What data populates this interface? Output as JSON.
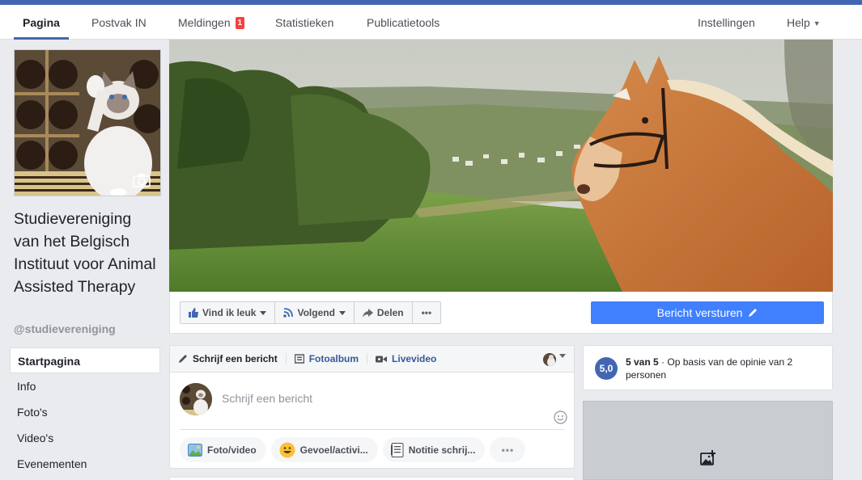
{
  "nav": {
    "tabs": [
      {
        "label": "Pagina"
      },
      {
        "label": "Postvak IN"
      },
      {
        "label": "Meldingen",
        "badge": "1"
      },
      {
        "label": "Statistieken"
      },
      {
        "label": "Publicatietools"
      }
    ],
    "settings": "Instellingen",
    "help": "Help",
    "help_caret": "▼"
  },
  "page": {
    "name": "Studievereniging van het Belgisch Instituut voor Animal Assisted Therapy",
    "handle": "@studievereniging"
  },
  "sidebar": {
    "items": [
      {
        "label": "Startpagina"
      },
      {
        "label": "Info"
      },
      {
        "label": "Foto's"
      },
      {
        "label": "Video's"
      },
      {
        "label": "Evenementen"
      }
    ]
  },
  "actions": {
    "like": "Vind ik leuk",
    "follow": "Volgend",
    "share": "Delen",
    "more": "•••",
    "send_message": "Bericht versturen"
  },
  "composer": {
    "tabs": [
      "Schrijf een bericht",
      "Fotoalbum",
      "Livevideo"
    ],
    "placeholder": "Schrijf een bericht",
    "buttons": [
      "Foto/video",
      "Gevoel/activi...",
      "Notitie schrij..."
    ],
    "more": "•••"
  },
  "rating": {
    "score": "5,0",
    "summary": "5 van 5",
    "separator": " · ",
    "detail": "Op basis van de opinie van 2 personen"
  },
  "colors": {
    "brand": "#4267b2",
    "send_button": "#4080ff",
    "badge": "#fa3e3e",
    "background": "#e9ebee"
  },
  "icons": [
    "camera-icon",
    "thumbs-up-icon",
    "rss-icon",
    "share-arrow-icon",
    "pencil-icon",
    "photo-album-icon",
    "video-camera-icon",
    "smiley-icon",
    "photo-icon",
    "emoji-icon",
    "note-icon",
    "add-photo-icon"
  ]
}
